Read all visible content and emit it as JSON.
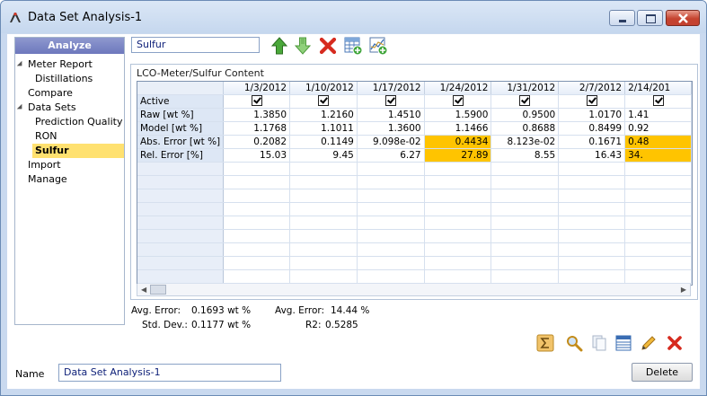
{
  "window": {
    "title": "Data Set Analysis-1"
  },
  "sidebar": {
    "header": "Analyze",
    "items": [
      {
        "label": "Meter Report",
        "level": 0,
        "expanded": true
      },
      {
        "label": "Distillations",
        "level": 1
      },
      {
        "label": "Compare",
        "level": 0
      },
      {
        "label": "Data Sets",
        "level": 0,
        "expanded": true
      },
      {
        "label": "Prediction Quality",
        "level": 1
      },
      {
        "label": "RON",
        "level": 1
      },
      {
        "label": "Sulfur",
        "level": 1,
        "selected": true
      },
      {
        "label": "Import",
        "level": 0
      },
      {
        "label": "Manage",
        "level": 0
      }
    ]
  },
  "toolbar": {
    "property_value": "Sulfur",
    "icons": [
      "move-up-icon",
      "move-down-icon",
      "delete-icon",
      "add-table-icon",
      "add-chart-icon"
    ]
  },
  "panel": {
    "title": "LCO-Meter/Sulfur Content",
    "columns": [
      "1/3/2012",
      "1/10/2012",
      "1/17/2012",
      "1/24/2012",
      "1/31/2012",
      "2/7/2012",
      "2/14/201"
    ],
    "rows": [
      {
        "label": "Active",
        "type": "checkbox",
        "cells": [
          true,
          true,
          true,
          true,
          true,
          true,
          true
        ]
      },
      {
        "label": "Raw [wt %]",
        "cells": [
          "1.3850",
          "1.2160",
          "1.4510",
          "1.5900",
          "0.9500",
          "1.0170",
          "1.41"
        ]
      },
      {
        "label": "Model [wt %]",
        "cells": [
          "1.1768",
          "1.1011",
          "1.3600",
          "1.1466",
          "0.8688",
          "0.8499",
          "0.92"
        ]
      },
      {
        "label": "Abs. Error [wt %]",
        "cells": [
          "0.2082",
          "0.1149",
          "9.098e-02",
          "0.4434",
          "8.123e-02",
          "0.1671",
          "0.48"
        ],
        "highlight": [
          3,
          6
        ]
      },
      {
        "label": "Rel. Error [%]",
        "cells": [
          "15.03",
          "9.45",
          "6.27",
          "27.89",
          "8.55",
          "16.43",
          "34."
        ],
        "highlight": [
          3,
          6
        ]
      }
    ],
    "empty_rows": 9,
    "highlight_color": "#ffc400"
  },
  "stats": {
    "avg_error_label": "Avg. Error:",
    "avg_error_value": "0.1693 wt %",
    "std_dev_label": "Std. Dev.:",
    "std_dev_value": "0.1177 wt %",
    "avg_error_pct_label": "Avg. Error:",
    "avg_error_pct_value": "14.44 %",
    "r2_label": "R2:",
    "r2_value": "0.5285"
  },
  "bottom_icons": [
    "sum-icon",
    "search-icon",
    "copy-icon",
    "table-icon",
    "edit-icon",
    "delete-icon"
  ],
  "footer": {
    "name_label": "Name",
    "name_value": "Data Set Analysis-1",
    "delete_label": "Delete"
  }
}
